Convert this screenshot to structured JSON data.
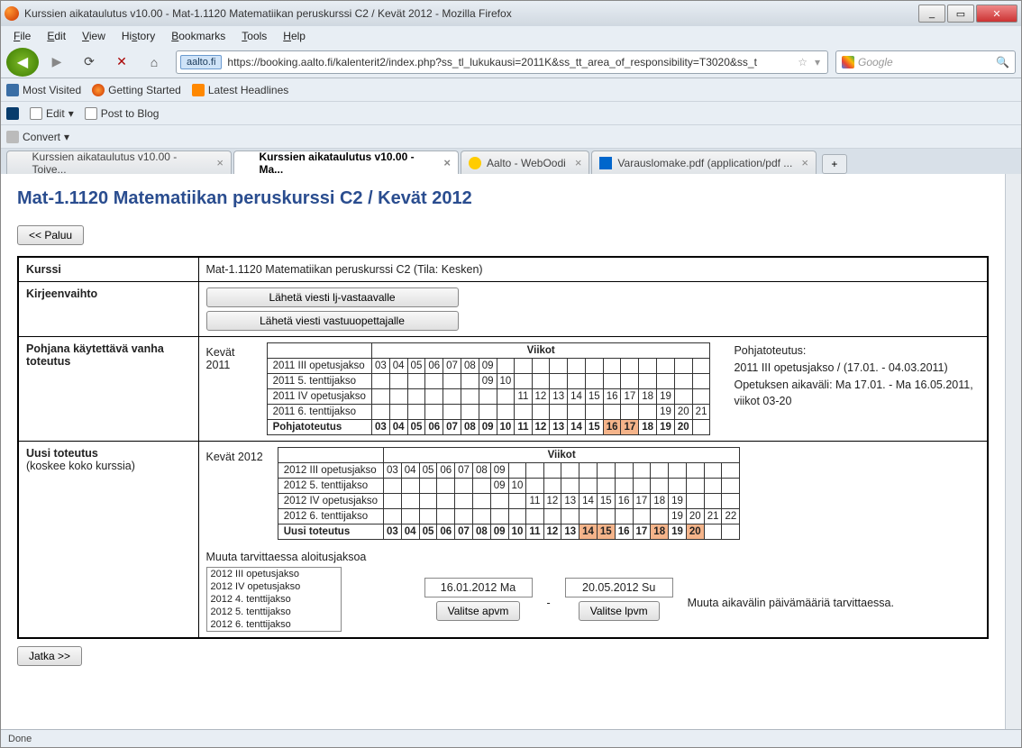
{
  "window": {
    "title": "Kurssien aikataulutus v10.00 - Mat-1.1120 Matematiikan peruskurssi C2 / Kevät 2012 - Mozilla Firefox",
    "minimize": "_",
    "maximize": "▭",
    "close": "✕"
  },
  "menu": {
    "file": "File",
    "edit": "Edit",
    "view": "View",
    "history": "History",
    "bookmarks": "Bookmarks",
    "tools": "Tools",
    "help": "Help"
  },
  "nav": {
    "url_host": "aalto.fi",
    "url": "https://booking.aalto.fi/kalenterit2/index.php?ss_tl_lukukausi=2011K&ss_tt_area_of_responsibility=T3020&ss_t",
    "search_engine": "Google"
  },
  "bookmarks1": {
    "most": "Most Visited",
    "start": "Getting Started",
    "headlines": "Latest Headlines"
  },
  "bookmarks2": {
    "edit": "Edit",
    "post": "Post to Blog",
    "convert": "Convert"
  },
  "tabs": {
    "t1": "Kurssien aikataulutus v10.00 - Toive...",
    "t2": "Kurssien aikataulutus v10.00 - Ma...",
    "t3": "Aalto - WebOodi",
    "t4": "Varauslomake.pdf (application/pdf ..."
  },
  "page": {
    "h1": "Mat-1.1120 Matematiikan peruskurssi C2 / Kevät 2012",
    "back_btn": "<< Paluu",
    "row_kurssi_lbl": "Kurssi",
    "row_kurssi_val": "Mat-1.1120 Matematiikan peruskurssi C2  (Tila: Kesken)",
    "row_kirje_lbl": "Kirjeenvaihto",
    "send_lj": "Lähetä viesti lj-vastaavalle",
    "send_vastuu": "Lähetä viesti vastuuopettajalle",
    "row_pohja_lbl": "Pohjana käytettävä vanha toteutus",
    "kevat2011": "Kevät 2011",
    "viikot": "Viikot",
    "wk_r1": "2011 III opetusjakso",
    "wk_r2": "2011 5. tenttijakso",
    "wk_r3": "2011 IV opetusjakso",
    "wk_r4": "2011 6. tenttijakso",
    "wk_r5": "Pohjatoteutus",
    "wk_nums": [
      "03",
      "04",
      "05",
      "06",
      "07",
      "08",
      "09",
      "10",
      "11",
      "12",
      "13",
      "14",
      "15",
      "16",
      "17",
      "18",
      "19",
      "20",
      "21"
    ],
    "pohja_info1": "Pohjatoteutus:",
    "pohja_info2": "2011 III opetusjakso / (17.01. - 04.03.2011)",
    "pohja_info3": "Opetuksen aikaväli: Ma 17.01. - Ma 16.05.2011, viikot 03-20",
    "row_uusi_lbl": "Uusi toteutus",
    "row_uusi_sub": "(koskee koko kurssia)",
    "kevat2012": "Kevät 2012",
    "u_r1": "2012 III opetusjakso",
    "u_r2": "2012 5. tenttijakso",
    "u_r3": "2012 IV opetusjakso",
    "u_r4": "2012 6. tenttijakso",
    "u_r5": "Uusi toteutus",
    "u_nums": [
      "03",
      "04",
      "05",
      "06",
      "07",
      "08",
      "09",
      "10",
      "11",
      "12",
      "13",
      "14",
      "15",
      "16",
      "17",
      "18",
      "19",
      "20",
      "21",
      "22"
    ],
    "muuta_aloitus": "Muuta tarvittaessa aloitusjaksoa",
    "list_items": [
      "2012 III opetusjakso",
      "2012 IV opetusjakso",
      "2012 4. tenttijakso",
      "2012 5. tenttijakso",
      "2012 6. tenttijakso"
    ],
    "date_start": "16.01.2012 Ma",
    "date_end": "20.05.2012 Su",
    "valitse_apvm": "Valitse apvm",
    "valitse_lpvm": "Valitse lpvm",
    "muuta_aika": "Muuta aikavälin päivämääriä tarvittaessa.",
    "jatka": "Jatka >>"
  },
  "status": {
    "done": "Done"
  }
}
